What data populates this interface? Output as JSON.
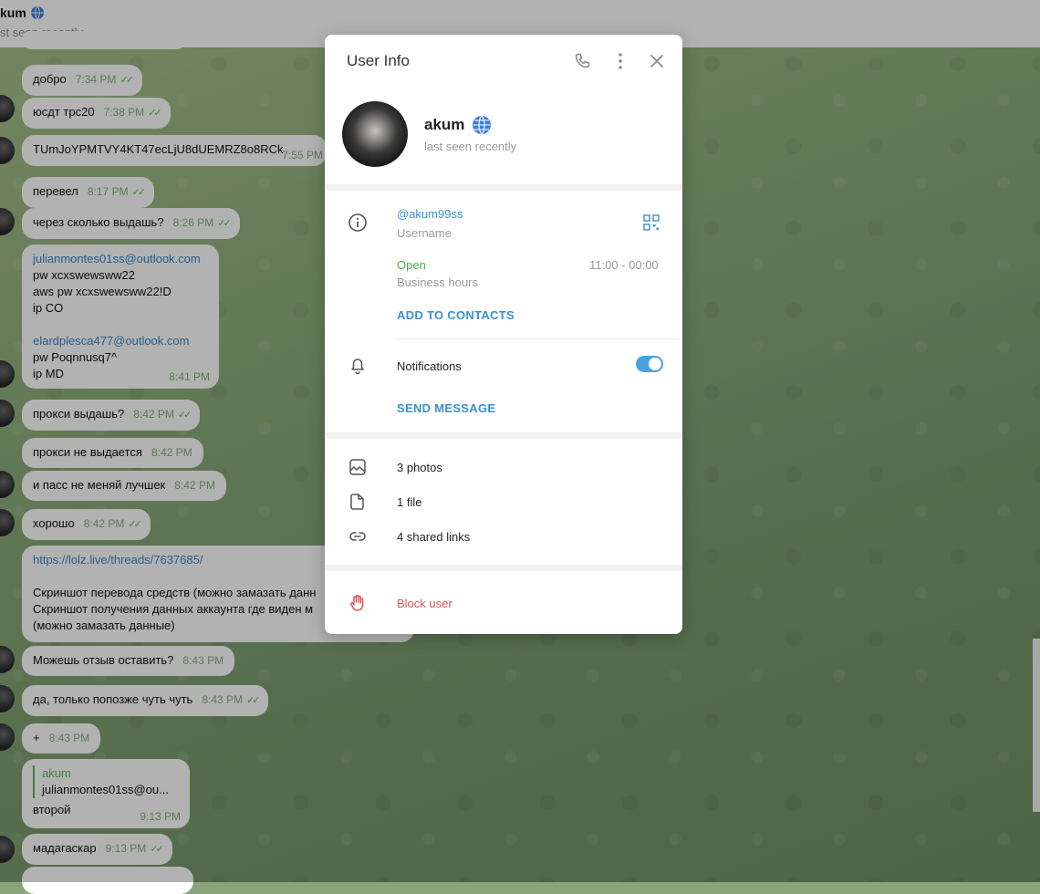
{
  "chat": {
    "header": {
      "name": "kum",
      "status": "st seen recently"
    },
    "messages": [
      {
        "text": "добро",
        "time": "7:34 PM"
      },
      {
        "text": "юсдт трс20",
        "time": "7:38 PM"
      },
      {
        "text": "TUmJoYPMTVY4KT47ecLjU8dUEMRZ8o8RCk",
        "time": "7:55 PM"
      },
      {
        "text": "перевел",
        "time": "8:17 PM"
      },
      {
        "text": "через сколько выдашь?",
        "time": "8:26 PM"
      },
      {
        "lines": [
          "julianmontes01ss@outlook.com",
          "pw xcxswewsww22",
          "aws pw xcxswewsww22!D",
          "ip CO",
          "",
          "elardplesca477@outlook.com",
          "pw Poqnnusq7^",
          "ip MD"
        ],
        "time": "8:41 PM"
      },
      {
        "text": "прокси выдашь?",
        "time": "8:42 PM"
      },
      {
        "text": "прокси не выдается",
        "time": "8:42 PM"
      },
      {
        "text": "и пасс не меняй лучшек",
        "time": "8:42 PM"
      },
      {
        "text": "хорошо",
        "time": "8:42 PM"
      },
      {
        "lines": [
          "https://lolz.live/threads/7637685/",
          "",
          "Скриншот перевода средств (можно замазать данн",
          "Скриншот получения данных аккаунта где виден м",
          "(можно замазать данные)"
        ]
      },
      {
        "text": "Можешь отзыв оставить?",
        "time": "8:43 PM"
      },
      {
        "text": "да, только попозже чуть чуть",
        "time": "8:43 PM"
      },
      {
        "text": "+",
        "time": "8:43 PM"
      },
      {
        "reply_name": "akum",
        "reply_text": "julianmontes01ss@ou...",
        "text": "второй",
        "time": "9:13 PM"
      },
      {
        "text": "мадагаскар",
        "time": "9:13 PM"
      }
    ]
  },
  "modal": {
    "title": "User Info",
    "name": "akum",
    "status": "last seen recently",
    "username": "@akum99ss",
    "username_label": "Username",
    "open_label": "Open",
    "hours": "11:00 - 00:00",
    "hours_label": "Business hours",
    "add_contacts": "ADD TO CONTACTS",
    "notifications": "Notifications",
    "notifications_on": true,
    "send_message": "SEND MESSAGE",
    "photos": "3 photos",
    "files": "1 file",
    "links": "4 shared links",
    "block": "Block user"
  },
  "icons": {
    "call": "phone-icon",
    "more": "more-vertical-icon",
    "close": "close-icon",
    "info": "info-icon",
    "qr": "qr-code-icon",
    "bell": "bell-icon",
    "photo": "photo-icon",
    "file": "file-icon",
    "link": "link-icon",
    "block": "hand-stop-icon",
    "verified": "globe-icon"
  },
  "colors": {
    "accent": "#3a8fd0",
    "open": "#4caf50",
    "danger": "#e05353",
    "check": "#5fb35a"
  }
}
